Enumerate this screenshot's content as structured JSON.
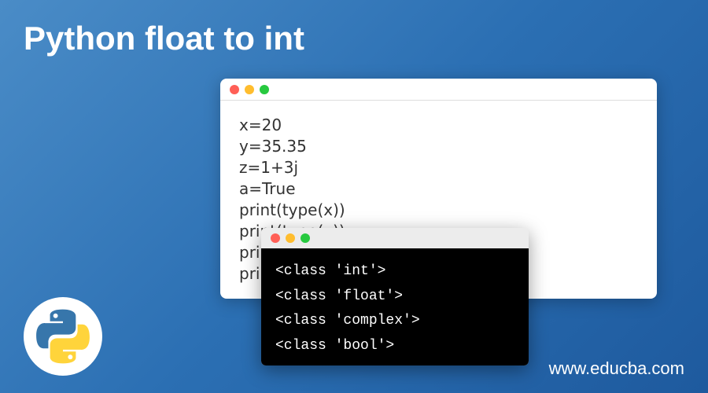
{
  "title": "Python float to int",
  "code_window": {
    "lines": [
      "x=20",
      "y=35.35",
      "z=1+3j",
      "a=True",
      "print(type(x))",
      "print(type(y))",
      "print(type(z))",
      "print(type(a))"
    ]
  },
  "terminal_window": {
    "lines": [
      "<class 'int'>",
      "<class 'float'>",
      "<class 'complex'>",
      "<class 'bool'>"
    ]
  },
  "website": "www.educba.com",
  "logo_name": "python-logo"
}
